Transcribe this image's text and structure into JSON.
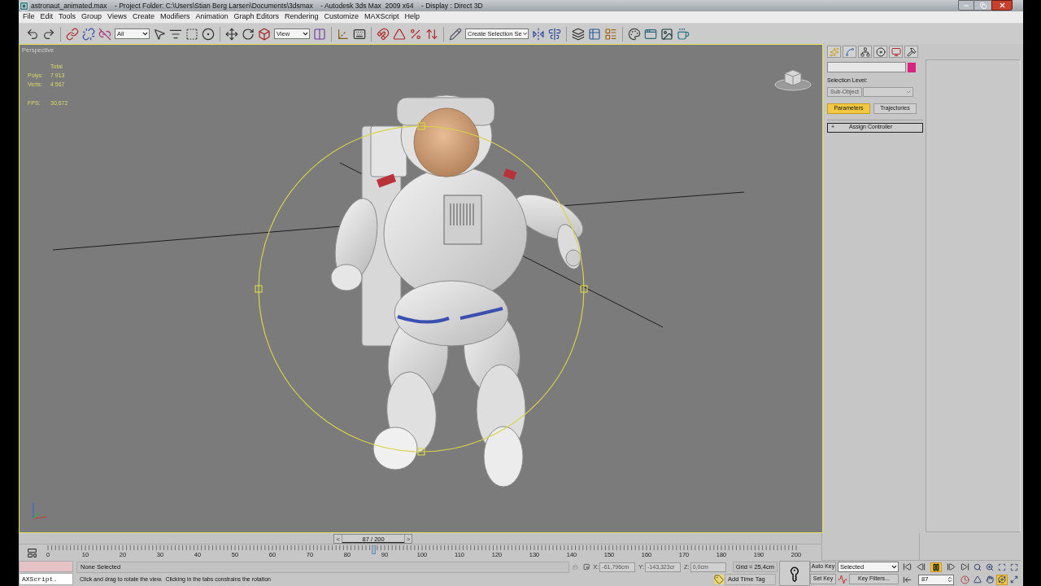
{
  "window": {
    "title": "astronaut_animated.max    - Project Folder: C:\\Users\\Stian Berg Larsen\\Documents\\3dsmax    - Autodesk 3ds Max  2009 x64    - Display : Direct 3D"
  },
  "menu": [
    "File",
    "Edit",
    "Tools",
    "Group",
    "Views",
    "Create",
    "Modifiers",
    "Animation",
    "Graph Editors",
    "Rendering",
    "Customize",
    "MAXScript",
    "Help"
  ],
  "toolbar": {
    "selection_filter": "All",
    "reference_coordinate_system": "View",
    "named_selection_set": "Create Selection Se"
  },
  "viewport": {
    "label": "Perspective",
    "active": true,
    "stats_heading": "Total",
    "stats": [
      {
        "label": "Polys:",
        "value": "7 913"
      },
      {
        "label": "Verts:",
        "value": "4 567"
      }
    ],
    "fps": {
      "label": "FPS:",
      "value": "30,672"
    }
  },
  "command_panel": {
    "selection_level_label": "Selection Level:",
    "sub_object": {
      "label": "Sub-Object",
      "disabled": true
    },
    "sub_tabs": [
      {
        "label": "Parameters",
        "selected": true
      },
      {
        "label": "Trajectories",
        "selected": false
      }
    ],
    "rollout": {
      "toggle": "+",
      "title": "Assign Controller"
    }
  },
  "timeline": {
    "slider": {
      "prev": "<",
      "label": "87 / 200",
      "next": ">",
      "level": 0.435
    },
    "ticks": [
      "0",
      "10",
      "20",
      "30",
      "40",
      "50",
      "60",
      "70",
      "80",
      "90",
      "100",
      "110",
      "120",
      "130",
      "140",
      "150",
      "160",
      "170",
      "180",
      "190",
      "200"
    ]
  },
  "status_bar": {
    "listener": "AXScript.",
    "selection": "None Selected",
    "prompt": "Click and drag to rotate the view.  Clicking in the tabs constrains the rotation",
    "coordinates": [
      {
        "axis": "X:",
        "value": "-61,796cm",
        "disabled": true
      },
      {
        "axis": "Y:",
        "value": "-143,323cr",
        "disabled": true
      },
      {
        "axis": "Z:",
        "value": "0,0cm",
        "disabled": true
      }
    ],
    "grid": "Grid = 25,4cm",
    "time_tag": "Add Time Tag"
  },
  "animation_controls": {
    "auto_key": {
      "label": "Auto Key",
      "on": false
    },
    "set_key": "Set Key",
    "key_set": "Selected",
    "key_filters": "Key Filters...",
    "playing": true,
    "current_frame": "87"
  },
  "navigation_tools": [
    {
      "selected": false
    },
    {
      "selected": false
    },
    {
      "selected": false
    },
    {
      "selected": false
    },
    {
      "selected": false
    },
    {
      "selected": false
    },
    {
      "selected": true
    },
    {
      "selected": false
    }
  ]
}
